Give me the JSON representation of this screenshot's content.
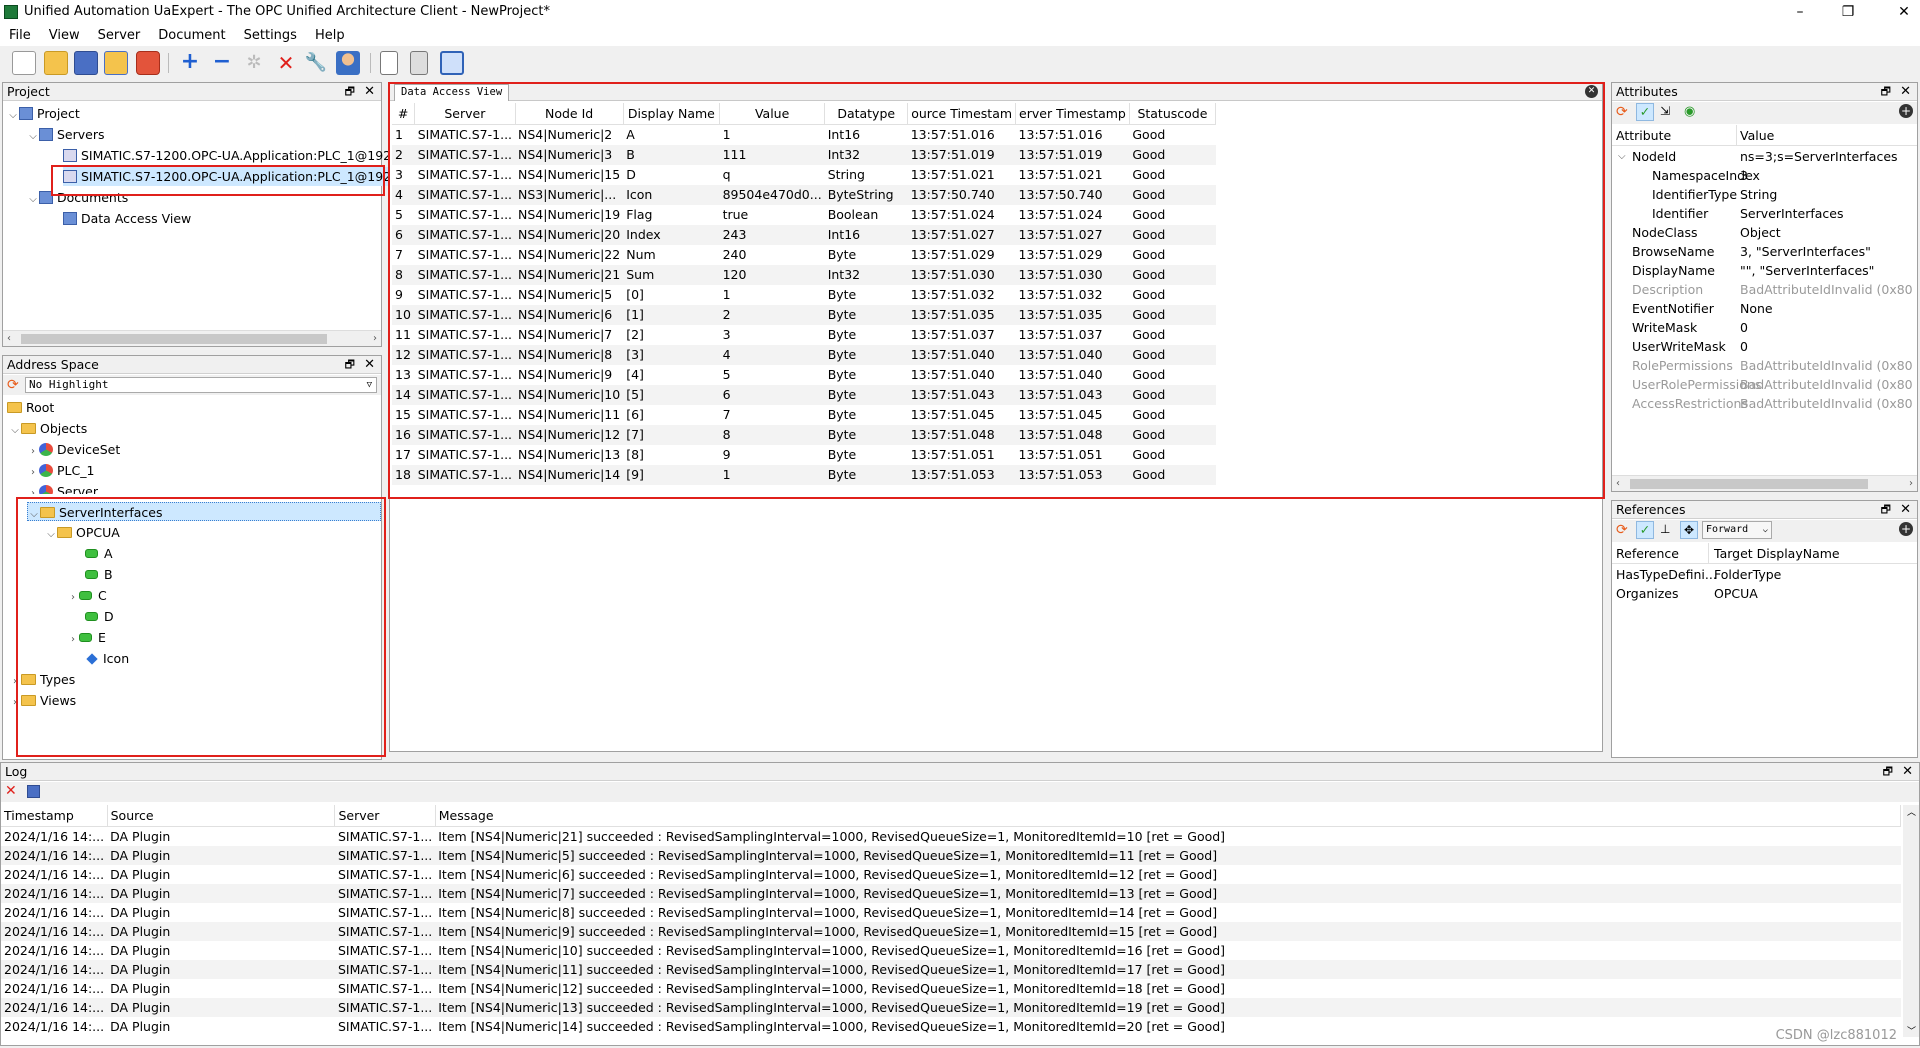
{
  "window": {
    "title": "Unified Automation UaExpert - The OPC Unified Architecture Client - NewProject*",
    "min": "–",
    "max": "❐",
    "close": "✕"
  },
  "menu": [
    "File",
    "View",
    "Server",
    "Document",
    "Settings",
    "Help"
  ],
  "toolbar_icons": [
    "new-document-icon",
    "open-folder-icon",
    "save-icon",
    "save-as-icon",
    "power-icon",
    "add-server-icon",
    "remove-server-icon",
    "connect-icon",
    "disconnect-icon",
    "settings-wrench-icon",
    "user-icon",
    "report-icon",
    "export-icon",
    "windows-icon"
  ],
  "project": {
    "title": "Project",
    "tree": {
      "root": "Project",
      "servers": "Servers",
      "server1": "SIMATIC.S7-1200.OPC-UA.Application:PLC_1@192.1",
      "server2": "SIMATIC.S7-1200.OPC-UA.Application:PLC_1@192.1",
      "documents": "Documents",
      "dav": "Data Access View"
    }
  },
  "address_space": {
    "title": "Address Space",
    "highlight": "No Highlight",
    "tree": {
      "root": "Root",
      "objects": "Objects",
      "deviceset": "DeviceSet",
      "plc": "PLC_1",
      "server": "Server",
      "serverinterfaces": "ServerInterfaces",
      "opcua": "OPCUA",
      "a": "A",
      "b": "B",
      "c": "C",
      "d": "D",
      "e": "E",
      "icon": "Icon",
      "types": "Types",
      "views": "Views"
    }
  },
  "dav": {
    "tab": "Data Access View",
    "columns": [
      "#",
      "Server",
      "Node Id",
      "Display Name",
      "Value",
      "Datatype",
      "ource Timestam",
      "erver Timestamp",
      "Statuscode"
    ],
    "rows": [
      [
        "1",
        "SIMATIC.S7-1...",
        "NS4|Numeric|2",
        "A",
        "1",
        "Int16",
        "13:57:51.016",
        "13:57:51.016",
        "Good"
      ],
      [
        "2",
        "SIMATIC.S7-1...",
        "NS4|Numeric|3",
        "B",
        "111",
        "Int32",
        "13:57:51.019",
        "13:57:51.019",
        "Good"
      ],
      [
        "3",
        "SIMATIC.S7-1...",
        "NS4|Numeric|15",
        "D",
        "q",
        "String",
        "13:57:51.021",
        "13:57:51.021",
        "Good"
      ],
      [
        "4",
        "SIMATIC.S7-1...",
        "NS3|Numeric|...",
        "Icon",
        "89504e470d0...",
        "ByteString",
        "13:57:50.740",
        "13:57:50.740",
        "Good"
      ],
      [
        "5",
        "SIMATIC.S7-1...",
        "NS4|Numeric|19",
        "Flag",
        "true",
        "Boolean",
        "13:57:51.024",
        "13:57:51.024",
        "Good"
      ],
      [
        "6",
        "SIMATIC.S7-1...",
        "NS4|Numeric|20",
        "Index",
        "243",
        "Int16",
        "13:57:51.027",
        "13:57:51.027",
        "Good"
      ],
      [
        "7",
        "SIMATIC.S7-1...",
        "NS4|Numeric|22",
        "Num",
        "240",
        "Byte",
        "13:57:51.029",
        "13:57:51.029",
        "Good"
      ],
      [
        "8",
        "SIMATIC.S7-1...",
        "NS4|Numeric|21",
        "Sum",
        "120",
        "Int32",
        "13:57:51.030",
        "13:57:51.030",
        "Good"
      ],
      [
        "9",
        "SIMATIC.S7-1...",
        "NS4|Numeric|5",
        "[0]",
        "1",
        "Byte",
        "13:57:51.032",
        "13:57:51.032",
        "Good"
      ],
      [
        "10",
        "SIMATIC.S7-1...",
        "NS4|Numeric|6",
        "[1]",
        "2",
        "Byte",
        "13:57:51.035",
        "13:57:51.035",
        "Good"
      ],
      [
        "11",
        "SIMATIC.S7-1...",
        "NS4|Numeric|7",
        "[2]",
        "3",
        "Byte",
        "13:57:51.037",
        "13:57:51.037",
        "Good"
      ],
      [
        "12",
        "SIMATIC.S7-1...",
        "NS4|Numeric|8",
        "[3]",
        "4",
        "Byte",
        "13:57:51.040",
        "13:57:51.040",
        "Good"
      ],
      [
        "13",
        "SIMATIC.S7-1...",
        "NS4|Numeric|9",
        "[4]",
        "5",
        "Byte",
        "13:57:51.040",
        "13:57:51.040",
        "Good"
      ],
      [
        "14",
        "SIMATIC.S7-1...",
        "NS4|Numeric|10",
        "[5]",
        "6",
        "Byte",
        "13:57:51.043",
        "13:57:51.043",
        "Good"
      ],
      [
        "15",
        "SIMATIC.S7-1...",
        "NS4|Numeric|11",
        "[6]",
        "7",
        "Byte",
        "13:57:51.045",
        "13:57:51.045",
        "Good"
      ],
      [
        "16",
        "SIMATIC.S7-1...",
        "NS4|Numeric|12",
        "[7]",
        "8",
        "Byte",
        "13:57:51.048",
        "13:57:51.048",
        "Good"
      ],
      [
        "17",
        "SIMATIC.S7-1...",
        "NS4|Numeric|13",
        "[8]",
        "9",
        "Byte",
        "13:57:51.051",
        "13:57:51.051",
        "Good"
      ],
      [
        "18",
        "SIMATIC.S7-1...",
        "NS4|Numeric|14",
        "[9]",
        "1",
        "Byte",
        "13:57:51.053",
        "13:57:51.053",
        "Good"
      ]
    ]
  },
  "attributes": {
    "title": "Attributes",
    "col_attr": "Attribute",
    "col_value": "Value",
    "rows": [
      [
        "NodeId",
        "ns=3;s=ServerInterfaces",
        false
      ],
      [
        "NamespaceIndex",
        "3",
        false
      ],
      [
        "IdentifierType",
        "String",
        false
      ],
      [
        "Identifier",
        "ServerInterfaces",
        false
      ],
      [
        "NodeClass",
        "Object",
        false
      ],
      [
        "BrowseName",
        "3, \"ServerInterfaces\"",
        false
      ],
      [
        "DisplayName",
        "\"\", \"ServerInterfaces\"",
        false
      ],
      [
        "Description",
        "BadAttributeIdInvalid (0x80",
        true
      ],
      [
        "EventNotifier",
        "None",
        false
      ],
      [
        "WriteMask",
        "0",
        false
      ],
      [
        "UserWriteMask",
        "0",
        false
      ],
      [
        "RolePermissions",
        "BadAttributeIdInvalid (0x80",
        true
      ],
      [
        "UserRolePermissions",
        "BadAttributeIdInvalid (0x80",
        true
      ],
      [
        "AccessRestrictions",
        "BadAttributeIdInvalid (0x80",
        true
      ]
    ]
  },
  "references": {
    "title": "References",
    "direction": "Forward",
    "col_ref": "Reference",
    "col_target": "Target DisplayName",
    "rows": [
      [
        "HasTypeDefini...",
        "FolderType"
      ],
      [
        "Organizes",
        "OPCUA"
      ]
    ]
  },
  "log": {
    "title": "Log",
    "columns": [
      "Timestamp",
      "Source",
      "Server",
      "Message"
    ],
    "rows": [
      [
        "2024/1/16 14:...",
        "DA Plugin",
        "SIMATIC.S7-1...",
        "Item [NS4|Numeric|21] succeeded : RevisedSamplingInterval=1000, RevisedQueueSize=1, MonitoredItemId=10 [ret = Good]"
      ],
      [
        "2024/1/16 14:...",
        "DA Plugin",
        "SIMATIC.S7-1...",
        "Item [NS4|Numeric|5] succeeded : RevisedSamplingInterval=1000, RevisedQueueSize=1, MonitoredItemId=11 [ret = Good]"
      ],
      [
        "2024/1/16 14:...",
        "DA Plugin",
        "SIMATIC.S7-1...",
        "Item [NS4|Numeric|6] succeeded : RevisedSamplingInterval=1000, RevisedQueueSize=1, MonitoredItemId=12 [ret = Good]"
      ],
      [
        "2024/1/16 14:...",
        "DA Plugin",
        "SIMATIC.S7-1...",
        "Item [NS4|Numeric|7] succeeded : RevisedSamplingInterval=1000, RevisedQueueSize=1, MonitoredItemId=13 [ret = Good]"
      ],
      [
        "2024/1/16 14:...",
        "DA Plugin",
        "SIMATIC.S7-1...",
        "Item [NS4|Numeric|8] succeeded : RevisedSamplingInterval=1000, RevisedQueueSize=1, MonitoredItemId=14 [ret = Good]"
      ],
      [
        "2024/1/16 14:...",
        "DA Plugin",
        "SIMATIC.S7-1...",
        "Item [NS4|Numeric|9] succeeded : RevisedSamplingInterval=1000, RevisedQueueSize=1, MonitoredItemId=15 [ret = Good]"
      ],
      [
        "2024/1/16 14:...",
        "DA Plugin",
        "SIMATIC.S7-1...",
        "Item [NS4|Numeric|10] succeeded : RevisedSamplingInterval=1000, RevisedQueueSize=1, MonitoredItemId=16 [ret = Good]"
      ],
      [
        "2024/1/16 14:...",
        "DA Plugin",
        "SIMATIC.S7-1...",
        "Item [NS4|Numeric|11] succeeded : RevisedSamplingInterval=1000, RevisedQueueSize=1, MonitoredItemId=17 [ret = Good]"
      ],
      [
        "2024/1/16 14:...",
        "DA Plugin",
        "SIMATIC.S7-1...",
        "Item [NS4|Numeric|12] succeeded : RevisedSamplingInterval=1000, RevisedQueueSize=1, MonitoredItemId=18 [ret = Good]"
      ],
      [
        "2024/1/16 14:...",
        "DA Plugin",
        "SIMATIC.S7-1...",
        "Item [NS4|Numeric|13] succeeded : RevisedSamplingInterval=1000, RevisedQueueSize=1, MonitoredItemId=19 [ret = Good]"
      ],
      [
        "2024/1/16 14:...",
        "DA Plugin",
        "SIMATIC.S7-1...",
        "Item [NS4|Numeric|14] succeeded : RevisedSamplingInterval=1000, RevisedQueueSize=1, MonitoredItemId=20 [ret = Good]"
      ]
    ]
  },
  "watermark": "CSDN @lzc881012",
  "colors": {
    "highlight_box": "#e0201b",
    "selection": "#cde8ff"
  }
}
